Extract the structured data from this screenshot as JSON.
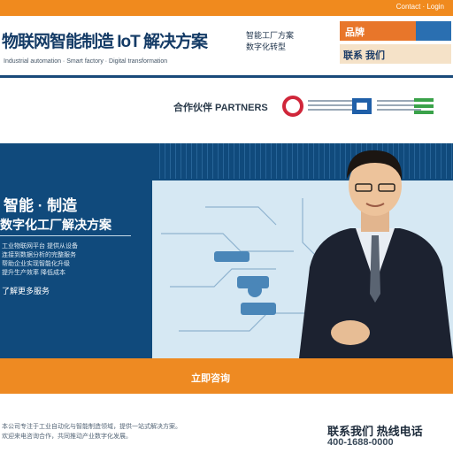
{
  "top_bar": {
    "link_text": "Contact · Login"
  },
  "header": {
    "title": "物联网智能制造 IoT 解决方案",
    "subtitle": "Industrial automation · Smart factory · Digital transformation",
    "side_text": "智能工厂方案\n数字化转型",
    "badge_label": "品牌",
    "badge2_label": "联系 我们"
  },
  "partners": {
    "label": "合作伙伴 PARTNERS",
    "logos": [
      "logo-red",
      "logo-blue",
      "logo-green"
    ]
  },
  "hero": {
    "headline": "智能 · 制造",
    "subheadline": "数字化工厂解决方案",
    "body": "工业物联网平台 提供从设备\n连接到数据分析的完整服务\n帮助企业实现智能化升级\n提升生产效率 降低成本",
    "caption": "了解更多服务"
  },
  "cta": {
    "label": "立即咨询"
  },
  "footer": {
    "text": "本公司专注于工业自动化与智能制造领域，提供一站式解决方案。\n欢迎来电咨询合作，共同推动产业数字化发展。",
    "heading": "联系我们 热线电话",
    "subheading": "400-1688-0000"
  },
  "colors": {
    "orange": "#ee8a22",
    "navy": "#104a7c",
    "light_panel": "#d6e8f3"
  }
}
